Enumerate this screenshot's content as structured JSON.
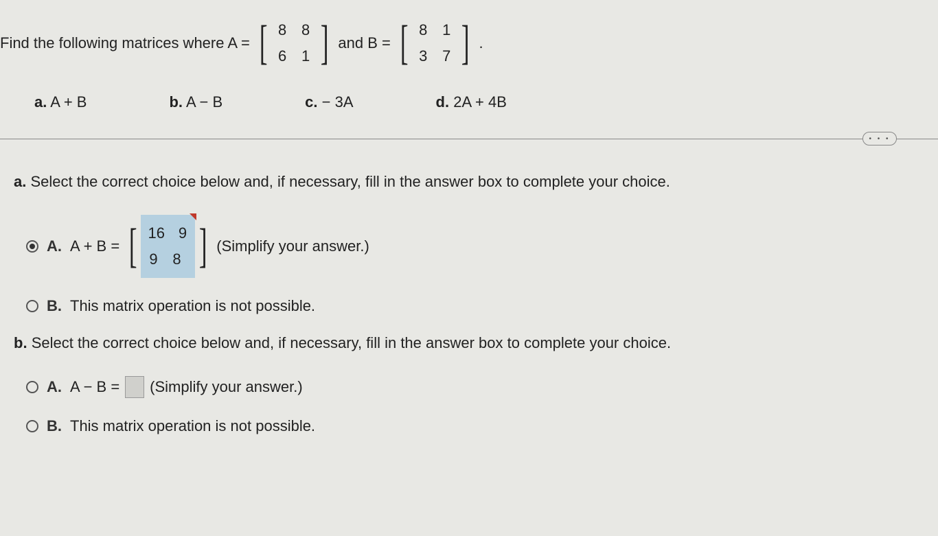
{
  "question": {
    "prefix": "Find the following matrices where A =",
    "mid": "and B =",
    "end": "",
    "matrixA": [
      [
        "8",
        "8"
      ],
      [
        "6",
        "1"
      ]
    ],
    "matrixB": [
      [
        "8",
        "1"
      ],
      [
        "3",
        "7"
      ]
    ]
  },
  "parts": [
    {
      "label": "a.",
      "expr": "A + B"
    },
    {
      "label": "b.",
      "expr": "A − B"
    },
    {
      "label": "c.",
      "expr": "− 3A"
    },
    {
      "label": "d.",
      "expr": "2A + 4B"
    }
  ],
  "dots": "• • •",
  "sectionA": {
    "label": "a.",
    "prompt": "Select the correct choice below and, if necessary, fill in the answer box to complete your choice.",
    "choiceA": {
      "label": "A.",
      "expr": "A + B =",
      "answerMatrix": [
        [
          "16",
          "9"
        ],
        [
          "9",
          "8"
        ]
      ],
      "hint": "(Simplify your answer.)"
    },
    "choiceB": {
      "label": "B.",
      "text": "This matrix operation is not possible."
    }
  },
  "sectionB": {
    "label": "b.",
    "prompt": "Select the correct choice below and, if necessary, fill in the answer box to complete your choice.",
    "choiceA": {
      "label": "A.",
      "expr": "A − B =",
      "hint": "(Simplify your answer.)"
    },
    "choiceB": {
      "label": "B.",
      "text": "This matrix operation is not possible."
    }
  }
}
